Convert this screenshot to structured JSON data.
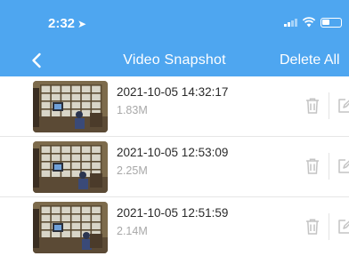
{
  "status_bar": {
    "time": "2:32",
    "location_icon": "location-arrow-icon",
    "signal_icon": "cellular-signal-icon",
    "wifi_icon": "wifi-icon",
    "battery_icon": "battery-icon"
  },
  "nav": {
    "back_icon": "chevron-left-icon",
    "title": "Video Snapshot",
    "delete_all_label": "Delete All"
  },
  "snapshots": [
    {
      "datetime": "2021-10-05 14:32:17",
      "size": "1.83M"
    },
    {
      "datetime": "2021-10-05 12:53:09",
      "size": "2.25M"
    },
    {
      "datetime": "2021-10-05 12:51:59",
      "size": "2.14M"
    }
  ],
  "row_icons": {
    "delete": "trash-icon",
    "edit": "edit-icon"
  },
  "colors": {
    "header_bg": "#4ea6f0",
    "header_text": "#ffffff",
    "primary_text": "#2a2a2a",
    "secondary_text": "#a8a8a8",
    "icon_gray": "#c4c4c4",
    "divider": "#e6e6e6"
  }
}
